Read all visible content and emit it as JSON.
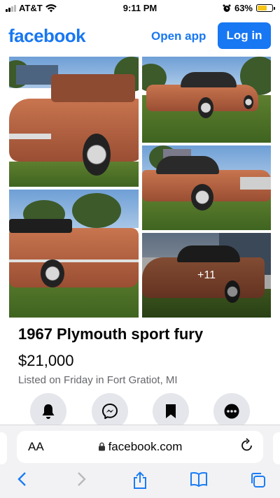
{
  "status_bar": {
    "carrier": "AT&T",
    "time": "9:11 PM",
    "battery_percent": "63%",
    "battery_level": 0.63
  },
  "header": {
    "logo": "facebook",
    "open_app": "Open app",
    "login": "Log in",
    "brand_color": "#1877f2"
  },
  "photos": {
    "more_count": "+11"
  },
  "listing": {
    "title": "1967 Plymouth sport fury",
    "price": "$21,000",
    "meta": "Listed on Friday in Fort Gratiot, MI"
  },
  "actions": [
    {
      "icon": "bell-icon"
    },
    {
      "icon": "messenger-icon"
    },
    {
      "icon": "bookmark-icon"
    },
    {
      "icon": "more-icon"
    }
  ],
  "browser": {
    "text_size": "AA",
    "url": "facebook.com"
  }
}
